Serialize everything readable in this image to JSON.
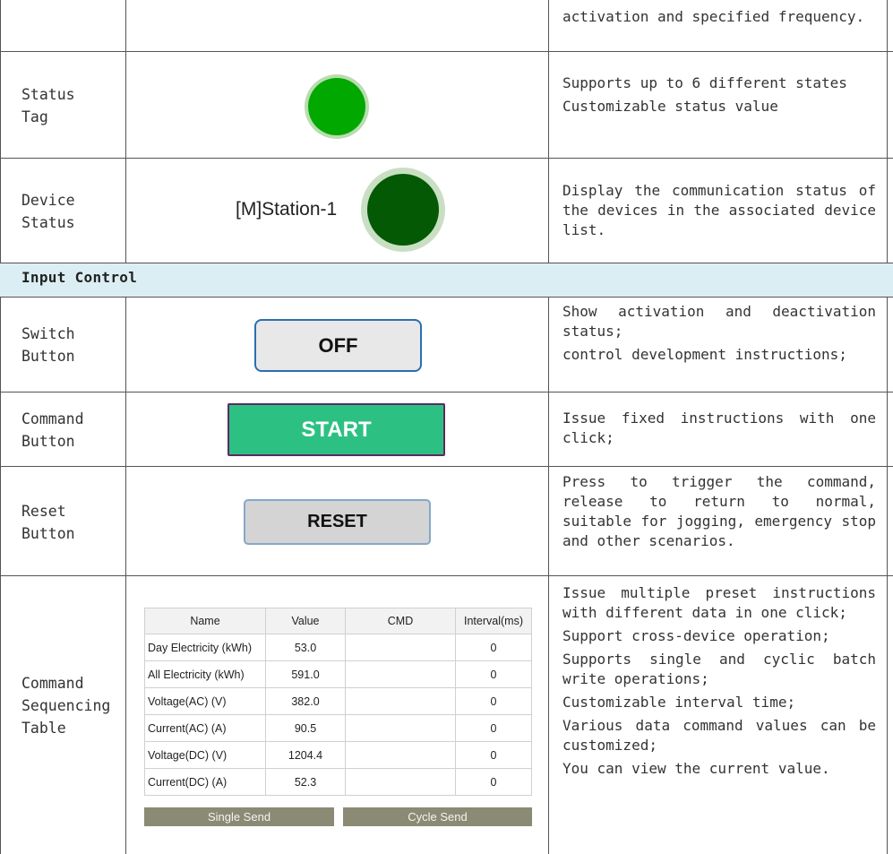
{
  "rows": {
    "top_partial": {
      "description": [
        "activation and specified frequency."
      ]
    },
    "status_tag": {
      "name": "Status Tag",
      "description": [
        "Supports up to 6 different states",
        "Customizable status value"
      ]
    },
    "device_status": {
      "name": "Device Status",
      "widget_label": "[M]Station-1",
      "description": [
        "Display the communication status of the devices in the associated device list."
      ]
    },
    "section_header": "Input Control",
    "switch_button": {
      "name": "Switch Button",
      "widget_label": "OFF",
      "description": [
        "Show activation and deactivation status;",
        "control development instructions;"
      ]
    },
    "command_button": {
      "name": "Command Button",
      "widget_label": "START",
      "description": [
        "Issue fixed instructions with one click;"
      ]
    },
    "reset_button": {
      "name": "Reset Button",
      "widget_label": "RESET",
      "description": [
        "Press to trigger the command, release to return to normal, suitable for jogging, emergency stop and other scenarios."
      ]
    },
    "command_sequencing_table": {
      "name": "Command Sequencing Table",
      "table": {
        "headers": [
          "Name",
          "Value",
          "CMD",
          "Interval(ms)"
        ],
        "rows": [
          [
            "Day Electricity  (kWh)",
            "53.0",
            "",
            "0"
          ],
          [
            "All Electricity  (kWh)",
            "591.0",
            "",
            "0"
          ],
          [
            "Voltage(AC) (V)",
            "382.0",
            "",
            "0"
          ],
          [
            "Current(AC) (A)",
            "90.5",
            "",
            "0"
          ],
          [
            "Voltage(DC) (V)",
            "1204.4",
            "",
            "0"
          ],
          [
            "Current(DC) (A)",
            "52.3",
            "",
            "0"
          ]
        ],
        "single_send": "Single Send",
        "cycle_send": "Cycle Send"
      },
      "description": [
        "Issue multiple preset instructions with different data in one click;",
        "Support cross-device operation;",
        "Supports single and cyclic batch write operations;",
        "Customizable interval time;",
        "Various data command values can be customized;",
        "You can view the current value."
      ]
    }
  },
  "colors": {
    "section_band": "#dbeef4",
    "status_green": "#00a800",
    "device_green": "#045904",
    "start_green": "#2cc183",
    "send_button": "#8b8a74"
  }
}
